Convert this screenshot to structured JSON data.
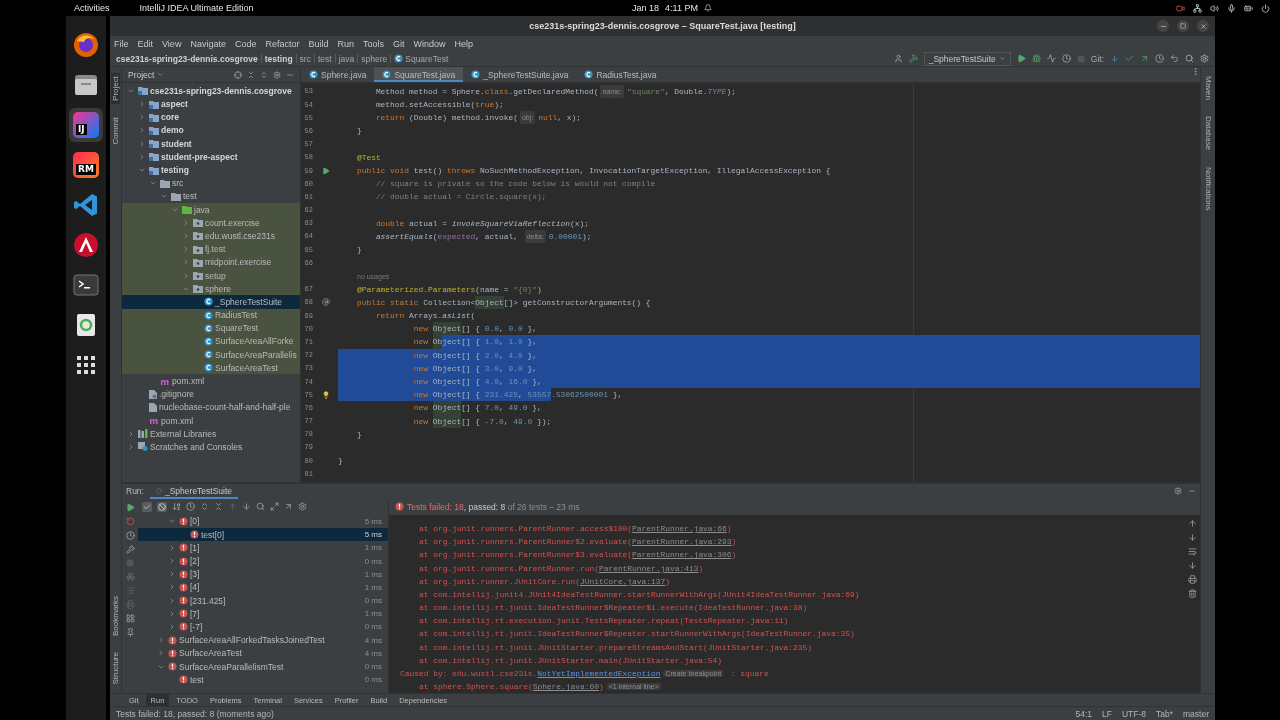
{
  "top_bar": {
    "activities": "Activities",
    "app": "IntelliJ IDEA Ultimate Edition",
    "date": "Jan 18",
    "time": "4:11 PM"
  },
  "dock": [
    {
      "kind": "firefox",
      "selected": false
    },
    {
      "kind": "files",
      "selected": false
    },
    {
      "kind": "intellij",
      "label": "IJ",
      "selected": true
    },
    {
      "kind": "rubymine",
      "label": "RM",
      "selected": false
    },
    {
      "kind": "vscode",
      "selected": false
    },
    {
      "kind": "arrow-app",
      "selected": false
    },
    {
      "kind": "terminal",
      "selected": false
    },
    {
      "kind": "trash",
      "selected": false
    },
    {
      "kind": "app-grid",
      "selected": false
    }
  ],
  "window": {
    "title": "cse231s-spring23-dennis.cosgrove – SquareTest.java [testing]"
  },
  "menu": [
    "File",
    "Edit",
    "View",
    "Navigate",
    "Code",
    "Refactor",
    "Build",
    "Run",
    "Tools",
    "Git",
    "Window",
    "Help"
  ],
  "breadcrumbs": [
    {
      "label": "cse231s-spring23-dennis.cosgrove",
      "kind": "root"
    },
    {
      "label": "testing",
      "kind": "module"
    },
    {
      "label": "src",
      "kind": "folder"
    },
    {
      "label": "test",
      "kind": "folder"
    },
    {
      "label": "java",
      "kind": "folder"
    },
    {
      "label": "sphere",
      "kind": "folder"
    },
    {
      "label": "SquareTest",
      "kind": "class"
    }
  ],
  "run_config": "_SphereTestSuite",
  "git_label": "Git:",
  "left_strip": {
    "top": [
      {
        "label": "Project",
        "selected": true
      },
      {
        "label": "Commit",
        "selected": false
      }
    ],
    "bottom": [
      {
        "label": "Bookmarks",
        "selected": false
      },
      {
        "label": "Structure",
        "selected": false
      }
    ]
  },
  "right_strip": [
    "Maven",
    "Database",
    "Notifications"
  ],
  "project_panel": {
    "title": "Project",
    "tree": [
      {
        "label": "cse231s-spring23-dennis.cosgrove",
        "kind": "module",
        "expanded": true,
        "selected": false,
        "scoped": false,
        "children": [
          {
            "label": "aspect",
            "kind": "module",
            "expanded": false,
            "selected": false,
            "scoped": false
          },
          {
            "label": "core",
            "kind": "module",
            "expanded": false,
            "selected": false,
            "scoped": false
          },
          {
            "label": "demo",
            "kind": "module",
            "expanded": false,
            "selected": false,
            "scoped": false
          },
          {
            "label": "student",
            "kind": "module",
            "expanded": false,
            "selected": false,
            "scoped": false
          },
          {
            "label": "student-pre-aspect",
            "kind": "module",
            "expanded": false,
            "selected": false,
            "scoped": false
          },
          {
            "label": "testing",
            "kind": "module",
            "expanded": true,
            "selected": false,
            "scoped": false,
            "children": [
              {
                "label": "src",
                "kind": "folder",
                "expanded": true,
                "selected": false,
                "scoped": false,
                "children": [
                  {
                    "label": "test",
                    "kind": "folder",
                    "expanded": true,
                    "selected": false,
                    "scoped": false,
                    "children": [
                      {
                        "label": "java",
                        "kind": "source-root",
                        "expanded": true,
                        "selected": false,
                        "scoped": true,
                        "children": [
                          {
                            "label": "count.exercise",
                            "kind": "package",
                            "expanded": false,
                            "selected": false,
                            "scoped": true
                          },
                          {
                            "label": "edu.wustl.cse231s",
                            "kind": "package",
                            "expanded": false,
                            "selected": false,
                            "scoped": true
                          },
                          {
                            "label": "fj.test",
                            "kind": "package",
                            "expanded": false,
                            "selected": false,
                            "scoped": true
                          },
                          {
                            "label": "midpoint.exercise",
                            "kind": "package",
                            "expanded": false,
                            "selected": false,
                            "scoped": true
                          },
                          {
                            "label": "setup",
                            "kind": "package",
                            "expanded": false,
                            "selected": false,
                            "scoped": true
                          },
                          {
                            "label": "sphere",
                            "kind": "package",
                            "expanded": true,
                            "selected": false,
                            "scoped": true,
                            "children": [
                              {
                                "label": "_SphereTestSuite",
                                "kind": "class",
                                "selected": true,
                                "scoped": true
                              },
                              {
                                "label": "RadiusTest",
                                "kind": "class",
                                "selected": false,
                                "scoped": true
                              },
                              {
                                "label": "SquareTest",
                                "kind": "class",
                                "selected": false,
                                "scoped": true
                              },
                              {
                                "label": "SurfaceAreaAllForke",
                                "kind": "class",
                                "selected": false,
                                "scoped": true
                              },
                              {
                                "label": "SurfaceAreaParallelis",
                                "kind": "class",
                                "selected": false,
                                "scoped": true
                              },
                              {
                                "label": "SurfaceAreaTest",
                                "kind": "class",
                                "selected": false,
                                "scoped": true
                              }
                            ]
                          }
                        ]
                      }
                    ]
                  }
                ]
              },
              {
                "label": "pom.xml",
                "kind": "maven",
                "selected": false,
                "scoped": false
              }
            ]
          },
          {
            "label": ".gitignore",
            "kind": "ignore",
            "selected": false,
            "scoped": false
          },
          {
            "label": "nucleobase-count-half-and-half-ple",
            "kind": "text",
            "selected": false,
            "scoped": false
          },
          {
            "label": "pom.xml",
            "kind": "maven",
            "selected": false,
            "scoped": false
          }
        ]
      },
      {
        "label": "External Libraries",
        "kind": "libraries",
        "expanded": false,
        "selected": false,
        "scoped": false
      },
      {
        "label": "Scratches and Consoles",
        "kind": "scratches",
        "expanded": false,
        "selected": false,
        "scoped": false
      }
    ]
  },
  "editor": {
    "tabs": [
      {
        "label": "Sphere.java",
        "selected": false
      },
      {
        "label": "SquareTest.java",
        "selected": true
      },
      {
        "label": "_SphereTestSuite.java",
        "selected": false
      },
      {
        "label": "RadiusTest.java",
        "selected": false
      }
    ],
    "lines": [
      {
        "kind": "code",
        "number": "53",
        "selected_to_end": false,
        "segments": [
          {
            "text": "        Method method = Sphere.",
            "kind": "plain"
          },
          {
            "text": "class",
            "kind": "keyword"
          },
          {
            "text": ".getDeclaredMethod(",
            "kind": "plain"
          },
          {
            "text": "name:",
            "kind": "hint"
          },
          {
            "text": "\"square\"",
            "kind": "string"
          },
          {
            "text": ", Double.",
            "kind": "plain"
          },
          {
            "text": "TYPE",
            "kind": "static-field"
          },
          {
            "text": ");",
            "kind": "plain"
          }
        ]
      },
      {
        "kind": "code",
        "number": "54",
        "selected_to_end": false,
        "segments": [
          {
            "text": "        method.setAccessible(",
            "kind": "plain"
          },
          {
            "text": "true",
            "kind": "keyword"
          },
          {
            "text": ");",
            "kind": "plain"
          }
        ]
      },
      {
        "kind": "code",
        "number": "55",
        "selected_to_end": false,
        "segments": [
          {
            "text": "        return",
            "kind": "keyword"
          },
          {
            "text": " (Double) method.invoke(",
            "kind": "plain"
          },
          {
            "text": "obj:",
            "kind": "hint"
          },
          {
            "text": "null",
            "kind": "keyword"
          },
          {
            "text": ", x);",
            "kind": "plain"
          }
        ]
      },
      {
        "kind": "code",
        "number": "56",
        "selected_to_end": false,
        "segments": [
          {
            "text": "    }",
            "kind": "plain"
          }
        ]
      },
      {
        "kind": "code",
        "number": "57",
        "selected_to_end": false
      },
      {
        "kind": "code",
        "number": "58",
        "selected_to_end": false,
        "segments": [
          {
            "text": "    @Test",
            "kind": "annotation"
          }
        ]
      },
      {
        "kind": "code",
        "number": "59",
        "selected_to_end": false,
        "gutter": {
          "kind": "run"
        },
        "segments": [
          {
            "text": "    public void",
            "kind": "keyword"
          },
          {
            "text": " test() ",
            "kind": "plain"
          },
          {
            "text": "throws",
            "kind": "keyword"
          },
          {
            "text": " NoSuchMethodException, InvocationTargetException, IllegalAccessException {",
            "kind": "plain"
          }
        ]
      },
      {
        "kind": "code",
        "number": "60",
        "selected_to_end": false,
        "segments": [
          {
            "text": "        // square is private so the code below is would not compile",
            "kind": "comment"
          }
        ]
      },
      {
        "kind": "code",
        "number": "61",
        "selected_to_end": false,
        "segments": [
          {
            "text": "        // double actual = Circle.square(x);",
            "kind": "comment"
          }
        ]
      },
      {
        "kind": "code",
        "number": "62",
        "selected_to_end": false
      },
      {
        "kind": "code",
        "number": "63",
        "selected_to_end": false,
        "segments": [
          {
            "text": "        double",
            "kind": "keyword"
          },
          {
            "text": " actual = ",
            "kind": "plain"
          },
          {
            "text": "invokeSquareViaReflection",
            "kind": "static-call"
          },
          {
            "text": "(x);",
            "kind": "plain"
          }
        ]
      },
      {
        "kind": "code",
        "number": "64",
        "selected_to_end": false,
        "segments": [
          {
            "text": "        assertEquals",
            "kind": "static-call"
          },
          {
            "text": "(",
            "kind": "plain"
          },
          {
            "text": "expected",
            "kind": "field"
          },
          {
            "text": ", actual, ",
            "kind": "plain"
          },
          {
            "text": "delta:",
            "kind": "hint"
          },
          {
            "text": "0.00001",
            "kind": "number"
          },
          {
            "text": ");",
            "kind": "plain"
          }
        ]
      },
      {
        "kind": "code",
        "number": "65",
        "selected_to_end": false,
        "segments": [
          {
            "text": "    }",
            "kind": "plain"
          }
        ]
      },
      {
        "kind": "code",
        "number": "66",
        "selected_to_end": false
      },
      {
        "kind": "inlay",
        "text": "no usages"
      },
      {
        "kind": "code",
        "number": "67",
        "selected_to_end": false,
        "segments": [
          {
            "text": "    @Parameterized.Parameters",
            "kind": "annotation"
          },
          {
            "text": "(name = ",
            "kind": "plain"
          },
          {
            "text": "\"{0}\"",
            "kind": "string"
          },
          {
            "text": ")",
            "kind": "plain"
          }
        ]
      },
      {
        "kind": "code",
        "number": "68",
        "selected_to_end": false,
        "gutter": {
          "kind": "at"
        },
        "segments": [
          {
            "text": "    public static",
            "kind": "keyword"
          },
          {
            "text": " Collection<",
            "kind": "plain"
          },
          {
            "text": "Object",
            "kind": "usage"
          },
          {
            "text": "[]> getConstructorArguments() {",
            "kind": "plain"
          }
        ]
      },
      {
        "kind": "code",
        "number": "69",
        "selected_to_end": false,
        "segments": [
          {
            "text": "        return",
            "kind": "keyword"
          },
          {
            "text": " Arrays.",
            "kind": "plain"
          },
          {
            "text": "asList",
            "kind": "static-call"
          },
          {
            "text": "(",
            "kind": "plain"
          }
        ]
      },
      {
        "kind": "code",
        "number": "70",
        "selected_to_end": false,
        "segments": [
          {
            "text": "                new ",
            "kind": "keyword"
          },
          {
            "text": "Object",
            "kind": "usage"
          },
          {
            "text": "[] { ",
            "kind": "plain"
          },
          {
            "text": "0.0",
            "kind": "number"
          },
          {
            "text": ", ",
            "kind": "plain"
          },
          {
            "text": "0.0",
            "kind": "number"
          },
          {
            "text": " },",
            "kind": "plain"
          }
        ]
      },
      {
        "kind": "code",
        "number": "71",
        "selected_to_end": true,
        "segments": [
          {
            "text": "                new ",
            "kind": "keyword",
            "selected": false
          },
          {
            "text": "Ob",
            "kind": "usage",
            "selected": false
          },
          {
            "text": "ject",
            "kind": "usage",
            "selected": true
          },
          {
            "text": "[] { ",
            "kind": "plain",
            "selected": true
          },
          {
            "text": "1.0",
            "kind": "number",
            "selected": true
          },
          {
            "text": ", ",
            "kind": "plain",
            "selected": true
          },
          {
            "text": "1.0",
            "kind": "number",
            "selected": true
          },
          {
            "text": " },",
            "kind": "plain",
            "selected": true
          }
        ]
      },
      {
        "kind": "code",
        "number": "72",
        "selected_to_end": true,
        "segments": [
          {
            "text": "                new ",
            "kind": "keyword",
            "selected": true
          },
          {
            "text": "Object",
            "kind": "usage",
            "selected": true
          },
          {
            "text": "[] { ",
            "kind": "plain",
            "selected": true
          },
          {
            "text": "2.0",
            "kind": "number",
            "selected": true
          },
          {
            "text": ", ",
            "kind": "plain",
            "selected": true
          },
          {
            "text": "4.0",
            "kind": "number",
            "selected": true
          },
          {
            "text": " },",
            "kind": "plain",
            "selected": true
          }
        ]
      },
      {
        "kind": "code",
        "number": "73",
        "selected_to_end": true,
        "segments": [
          {
            "text": "                new ",
            "kind": "keyword",
            "selected": true
          },
          {
            "text": "Object",
            "kind": "usage",
            "selected": true
          },
          {
            "text": "[] { ",
            "kind": "plain",
            "selected": true
          },
          {
            "text": "3.0",
            "kind": "number",
            "selected": true
          },
          {
            "text": ", ",
            "kind": "plain",
            "selected": true
          },
          {
            "text": "9.0",
            "kind": "number",
            "selected": true
          },
          {
            "text": " },",
            "kind": "plain",
            "selected": true
          }
        ]
      },
      {
        "kind": "code",
        "number": "74",
        "selected_to_end": true,
        "segments": [
          {
            "text": "                new ",
            "kind": "keyword",
            "selected": true
          },
          {
            "text": "Object",
            "kind": "usage",
            "selected": true
          },
          {
            "text": "[] { ",
            "kind": "plain",
            "selected": true
          },
          {
            "text": "4.0",
            "kind": "number",
            "selected": true
          },
          {
            "text": ", ",
            "kind": "plain",
            "selected": true
          },
          {
            "text": "16.0",
            "kind": "number",
            "selected": true
          },
          {
            "text": " },",
            "kind": "plain",
            "selected": true
          }
        ]
      },
      {
        "kind": "code",
        "number": "75",
        "selected_to_end": false,
        "gutter": {
          "kind": "bulb"
        },
        "segments": [
          {
            "text": "                new ",
            "kind": "keyword",
            "selected": true
          },
          {
            "text": "Object",
            "kind": "usage",
            "selected": true
          },
          {
            "text": "[] { ",
            "kind": "plain",
            "selected": true
          },
          {
            "text": "231.425",
            "kind": "number",
            "selected": true
          },
          {
            "text": ", ",
            "kind": "plain",
            "selected": true
          },
          {
            "text": "53557",
            "kind": "number",
            "selected": true
          },
          {
            "text": ".53062500001",
            "kind": "number",
            "selected": false
          },
          {
            "text": " },",
            "kind": "plain",
            "selected": false
          }
        ]
      },
      {
        "kind": "code",
        "number": "76",
        "selected_to_end": false,
        "segments": [
          {
            "text": "                new ",
            "kind": "keyword"
          },
          {
            "text": "Object",
            "kind": "usage"
          },
          {
            "text": "[] { ",
            "kind": "plain"
          },
          {
            "text": "7.0",
            "kind": "number"
          },
          {
            "text": ", ",
            "kind": "plain"
          },
          {
            "text": "49.0",
            "kind": "number"
          },
          {
            "text": " },",
            "kind": "plain"
          }
        ]
      },
      {
        "kind": "code",
        "number": "77",
        "selected_to_end": false,
        "segments": [
          {
            "text": "                new ",
            "kind": "keyword"
          },
          {
            "text": "Object",
            "kind": "usage"
          },
          {
            "text": "[] { ",
            "kind": "plain"
          },
          {
            "text": "-7.0",
            "kind": "number"
          },
          {
            "text": ", ",
            "kind": "plain"
          },
          {
            "text": "49.0",
            "kind": "number"
          },
          {
            "text": " });",
            "kind": "plain"
          }
        ]
      },
      {
        "kind": "code",
        "number": "78",
        "selected_to_end": false,
        "segments": [
          {
            "text": "    }",
            "kind": "plain"
          }
        ]
      },
      {
        "kind": "code",
        "number": "79",
        "selected_to_end": false
      },
      {
        "kind": "code",
        "number": "80",
        "selected_to_end": false,
        "segments": [
          {
            "text": "}",
            "kind": "plain"
          }
        ]
      },
      {
        "kind": "code",
        "number": "81",
        "selected_to_end": false
      }
    ]
  },
  "run_panel": {
    "title": "Run:",
    "tab": "_SphereTestSuite",
    "summary": [
      {
        "text": "Tests failed: 18",
        "kind": "failed"
      },
      {
        "text": ", passed: 8",
        "kind": "passed"
      },
      {
        "text": " of 26 tests – 23 ms",
        "kind": "muted"
      }
    ],
    "tree": {
      "continued": [
        {
          "label": "[0]",
          "time": "5 ms",
          "expanded": true,
          "selected": false,
          "children": [
            {
              "label": "test[0]",
              "time": "5 ms",
              "selected": true
            }
          ]
        },
        {
          "label": "[1]",
          "time": "1 ms",
          "expanded": false,
          "selected": false
        },
        {
          "label": "[2]",
          "time": "0 ms",
          "expanded": false,
          "selected": false
        },
        {
          "label": "[3]",
          "time": "1 ms",
          "expanded": false,
          "selected": false
        },
        {
          "label": "[4]",
          "time": "1 ms",
          "expanded": false,
          "selected": false
        },
        {
          "label": "[231.425]",
          "time": "0 ms",
          "expanded": false,
          "selected": false
        },
        {
          "label": "[7]",
          "time": "1 ms",
          "expanded": false,
          "selected": false
        },
        {
          "label": "[-7]",
          "time": "0 ms",
          "expanded": false,
          "selected": false
        }
      ],
      "items": [
        {
          "label": "SurfaceAreaAllForkedTasksJoinedTest",
          "time": "4 ms",
          "expanded": false,
          "selected": false
        },
        {
          "label": "SurfaceAreaTest",
          "time": "4 ms",
          "expanded": false,
          "selected": false
        },
        {
          "label": "SurfaceAreaParallelismTest",
          "time": "0 ms",
          "expanded": true,
          "selected": false,
          "children": [
            {
              "label": "test",
              "time": "0 ms",
              "selected": false
            }
          ]
        }
      ]
    },
    "console": [
      {
        "kind": "frame",
        "segments": [
          {
            "text": "at org.junit.runners.ParentRunner.access$100(",
            "kind": "plain"
          },
          {
            "text": "ParentRunner.java:66",
            "kind": "link"
          },
          {
            "text": ")",
            "kind": "plain"
          }
        ]
      },
      {
        "kind": "frame",
        "segments": [
          {
            "text": "at org.junit.runners.ParentRunner$2.evaluate(",
            "kind": "plain"
          },
          {
            "text": "ParentRunner.java:293",
            "kind": "link"
          },
          {
            "text": ")",
            "kind": "plain"
          }
        ]
      },
      {
        "kind": "frame",
        "segments": [
          {
            "text": "at org.junit.runners.ParentRunner$3.evaluate(",
            "kind": "plain"
          },
          {
            "text": "ParentRunner.java:306",
            "kind": "link"
          },
          {
            "text": ")",
            "kind": "plain"
          }
        ]
      },
      {
        "kind": "frame",
        "segments": [
          {
            "text": "at org.junit.runners.ParentRunner.run(",
            "kind": "plain"
          },
          {
            "text": "ParentRunner.java:413",
            "kind": "link"
          },
          {
            "text": ")",
            "kind": "plain"
          }
        ]
      },
      {
        "kind": "frame",
        "segments": [
          {
            "text": "at org.junit.runner.JUnitCore.run(",
            "kind": "plain"
          },
          {
            "text": "JUnitCore.java:137",
            "kind": "link"
          },
          {
            "text": ")",
            "kind": "plain"
          }
        ]
      },
      {
        "kind": "frame",
        "segments": [
          {
            "text": "at com.intellij.junit4.JUnit4IdeaTestRunner.startRunnerWithArgs(JUnit4IdeaTestRunner.java:69)",
            "kind": "plain"
          }
        ]
      },
      {
        "kind": "frame",
        "segments": [
          {
            "text": "at com.intellij.rt.junit.IdeaTestRunner$Repeater$1.execute(IdeaTestRunner.java:38)",
            "kind": "plain"
          }
        ]
      },
      {
        "kind": "frame",
        "segments": [
          {
            "text": "at com.intellij.rt.execution.junit.TestsRepeater.repeat(TestsRepeater.java:11)",
            "kind": "plain"
          }
        ]
      },
      {
        "kind": "frame",
        "segments": [
          {
            "text": "at com.intellij.rt.junit.IdeaTestRunner$Repeater.startRunnerWithArgs(IdeaTestRunner.java:35)",
            "kind": "plain"
          }
        ]
      },
      {
        "kind": "frame",
        "segments": [
          {
            "text": "at com.intellij.rt.junit.JUnitStarter.prepareStreamsAndStart(JUnitStarter.java:235)",
            "kind": "plain"
          }
        ]
      },
      {
        "kind": "frame",
        "segments": [
          {
            "text": "at com.intellij.rt.junit.JUnitStarter.main(JUnitStarter.java:54)",
            "kind": "plain"
          }
        ]
      },
      {
        "kind": "cause",
        "segments": [
          {
            "text": "Caused by: edu.wustl.cse231s.",
            "kind": "plain"
          },
          {
            "text": "NotYetImplementedException",
            "kind": "exception-link"
          },
          {
            "text": "Create breakpoint",
            "kind": "hint"
          },
          {
            "text": " : square",
            "kind": "plain"
          }
        ]
      },
      {
        "kind": "frame",
        "segments": [
          {
            "text": "at sphere.Sphere.square(",
            "kind": "plain"
          },
          {
            "text": "Sphere.java:60",
            "kind": "link"
          },
          {
            "text": ")",
            "kind": "plain"
          },
          {
            "text": "<1 internal line>",
            "kind": "hint"
          }
        ]
      }
    ]
  },
  "tool_tabs": [
    {
      "label": "Git",
      "selected": false
    },
    {
      "label": "Run",
      "selected": true
    },
    {
      "label": "TODO",
      "selected": false
    },
    {
      "label": "Problems",
      "selected": false
    },
    {
      "label": "Terminal",
      "selected": false
    },
    {
      "label": "Services",
      "selected": false
    },
    {
      "label": "Profiler",
      "selected": false
    },
    {
      "label": "Build",
      "selected": false
    },
    {
      "label": "Dependencies",
      "selected": false
    }
  ],
  "status_bar": {
    "message": "Tests failed: 18, passed: 8 (moments ago)",
    "items": [
      "54:1",
      "LF",
      "UTF-8",
      "Tab*",
      "master"
    ]
  }
}
